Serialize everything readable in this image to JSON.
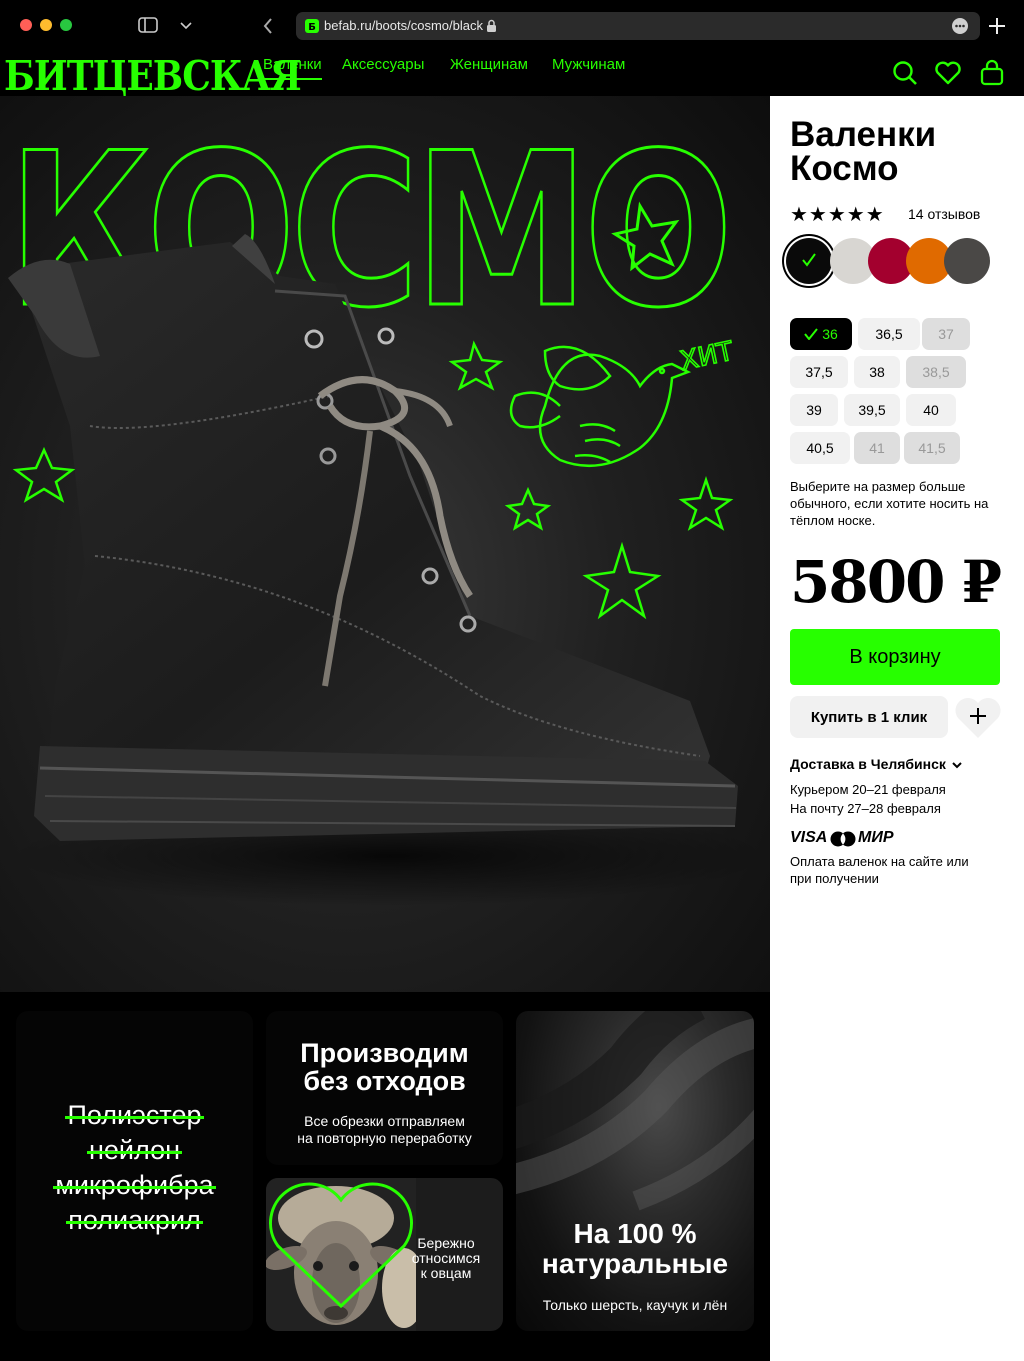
{
  "browser": {
    "url": "befab.ru/boots/cosmo/black",
    "colors": {
      "close": "#ff5f57",
      "minimize": "#febc2e",
      "maximize": "#28c840"
    }
  },
  "header": {
    "logo": "БИТЦЕВСКАЯ",
    "nav": [
      "Валенки",
      "Аксессуары",
      "Женщинам",
      "Мужчинам"
    ],
    "accent": "#27ff00"
  },
  "hero": {
    "title": "КОСМО",
    "hit_label": "ХИТ"
  },
  "product": {
    "title_line1": "Валенки",
    "title_line2": "Космо",
    "rating_stars": "★★★★★",
    "rating": 5,
    "reviews": "14 отзывов",
    "colors": [
      "#0a0a0a",
      "#d8d6d2",
      "#a3002e",
      "#e06a00",
      "#4a4846"
    ],
    "selected_color_index": 0,
    "sizes": [
      {
        "label": "36",
        "state": "selected"
      },
      {
        "label": "36,5",
        "state": "available"
      },
      {
        "label": "37",
        "state": "unavailable"
      },
      {
        "label": "37,5",
        "state": "available"
      },
      {
        "label": "38",
        "state": "available"
      },
      {
        "label": "38,5",
        "state": "unavailable"
      },
      {
        "label": "39",
        "state": "available"
      },
      {
        "label": "39,5",
        "state": "available"
      },
      {
        "label": "40",
        "state": "available"
      },
      {
        "label": "40,5",
        "state": "available"
      },
      {
        "label": "41",
        "state": "unavailable"
      },
      {
        "label": "41,5",
        "state": "unavailable"
      }
    ],
    "size_hint": "Выберите на размер больше обычного, если хотите носить на тёплом носке.",
    "price": "5800 ₽",
    "add_to_cart": "В корзину",
    "buy_one_click": "Купить в 1 клик",
    "delivery_title": "Доставка в Челябинск",
    "delivery_courier": "Курьером 20–21 февраля",
    "delivery_post": "На почту 27–28 февраля",
    "payment_visa": "VISA",
    "payment_mir": "МИР",
    "payment_note": "Оплата валенок на сайте или при получении"
  },
  "features": {
    "materials": [
      "Полиэстер",
      "нейлон",
      "микрофибра",
      "полиакрил"
    ],
    "no_waste_title_1": "Производим",
    "no_waste_title_2": "без отходов",
    "no_waste_text_1": "Все обрезки отправляем",
    "no_waste_text_2": "на повторную переработку",
    "sheep_text_1": "Бережно",
    "sheep_text_2": "относимся",
    "sheep_text_3": "к овцам",
    "natural_title_1": "На 100 %",
    "natural_title_2": "натуральные",
    "natural_text": "Только шерсть, каучук и лён"
  }
}
